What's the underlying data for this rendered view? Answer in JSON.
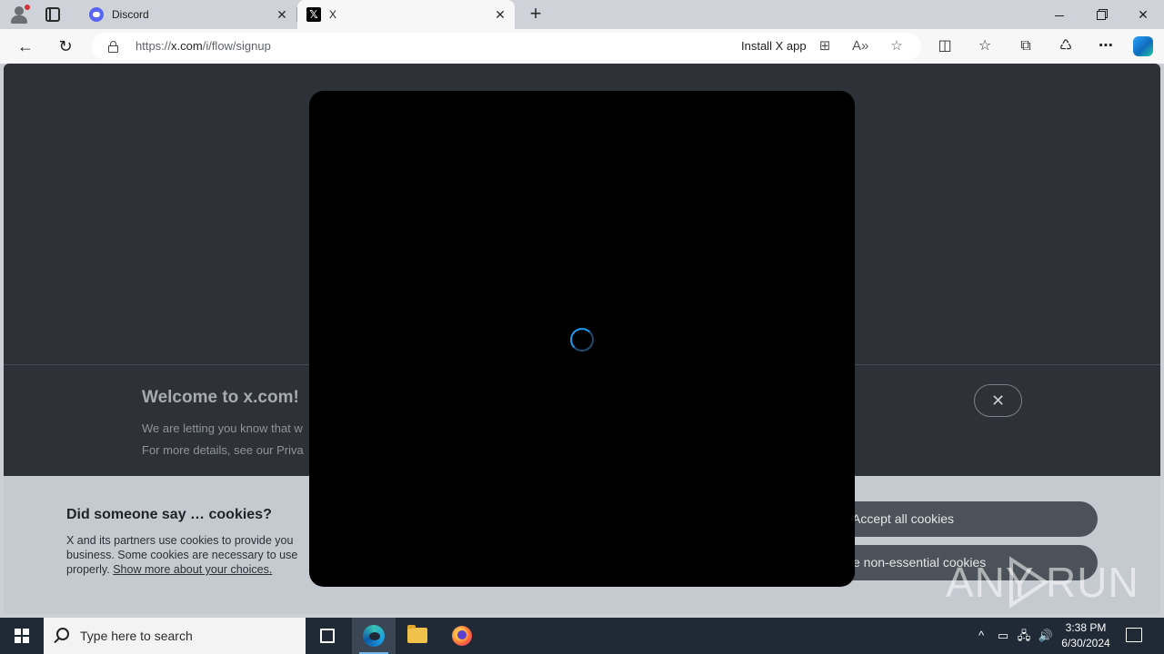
{
  "browser": {
    "tabs": [
      {
        "title": "Discord",
        "close": "✕"
      },
      {
        "title": "X",
        "close": "✕",
        "favicon": "𝕏"
      }
    ],
    "new_tab": "+",
    "window_controls": {
      "close": "✕"
    },
    "url_prefix": "https://",
    "url_host": "x.com",
    "url_path": "/i/flow/signup",
    "install_app": "Install X app",
    "nav_icons": {
      "back": "←",
      "reload": "↻"
    },
    "omni_icons": {
      "apps": "⊞",
      "read": "A»",
      "favorite": "☆"
    },
    "toolbar_icons": {
      "split": "◫",
      "favorites": "☆",
      "collections": "⧉",
      "extensions": "♺",
      "more": "⋯"
    }
  },
  "page": {
    "welcome_title": "Welcome to x.com!",
    "welcome_line1": "We are letting you know that w",
    "welcome_line2": "For more details, see our Priva",
    "welcome_close": "✕",
    "cookie_title": "Did someone say … cookies?",
    "cookie_text_1": "X and its partners use cookies to provide you",
    "cookie_text_2": "business. Some cookies are necessary to use",
    "cookie_text_3": "properly.",
    "cookie_link": "Show more about your choices.",
    "accept_label": "Accept all cookies",
    "refuse_label": "e non-essential cookies",
    "spinner_color": "#1d9bf0"
  },
  "watermark": {
    "left": "ANY",
    "right": "RUN"
  },
  "taskbar": {
    "search_placeholder": "Type here to search",
    "tray_up": "^",
    "time": "3:38 PM",
    "date": "6/30/2024"
  }
}
